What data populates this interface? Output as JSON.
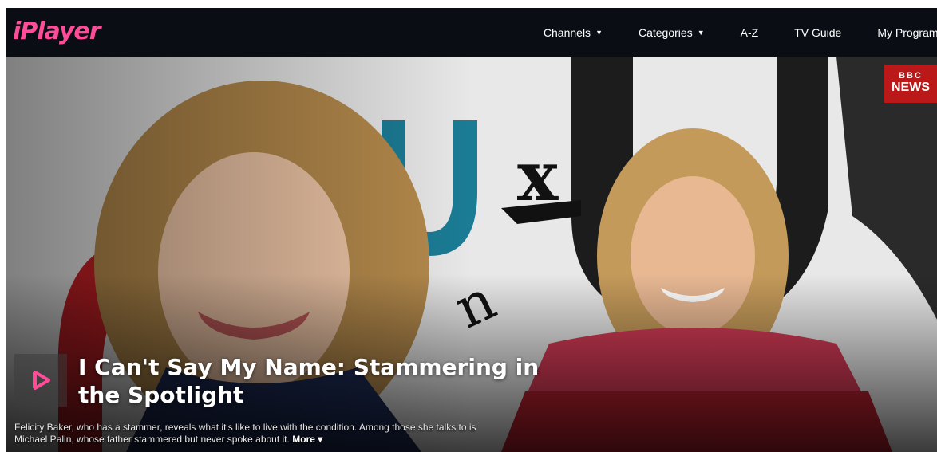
{
  "header": {
    "logo_text": "iPlayer",
    "nav": [
      {
        "label": "Channels",
        "has_dropdown": true
      },
      {
        "label": "Categories",
        "has_dropdown": true
      },
      {
        "label": "A-Z",
        "has_dropdown": false
      },
      {
        "label": "TV Guide",
        "has_dropdown": false
      },
      {
        "label": "My Programmes",
        "has_dropdown": false
      }
    ]
  },
  "hero": {
    "badge_bbc": "BBC",
    "badge_news": "NEWS",
    "title": "I Can't Say My Name: Stammering in the Spotlight",
    "description": "Felicity Baker, who has a stammer, reveals what it's like to live with the condition. Among those she talks to is Michael Palin, whose father stammered but never spoke about it.",
    "more_label": "More",
    "accent_color": "#ff4c98",
    "badge_color": "#bb1919"
  }
}
